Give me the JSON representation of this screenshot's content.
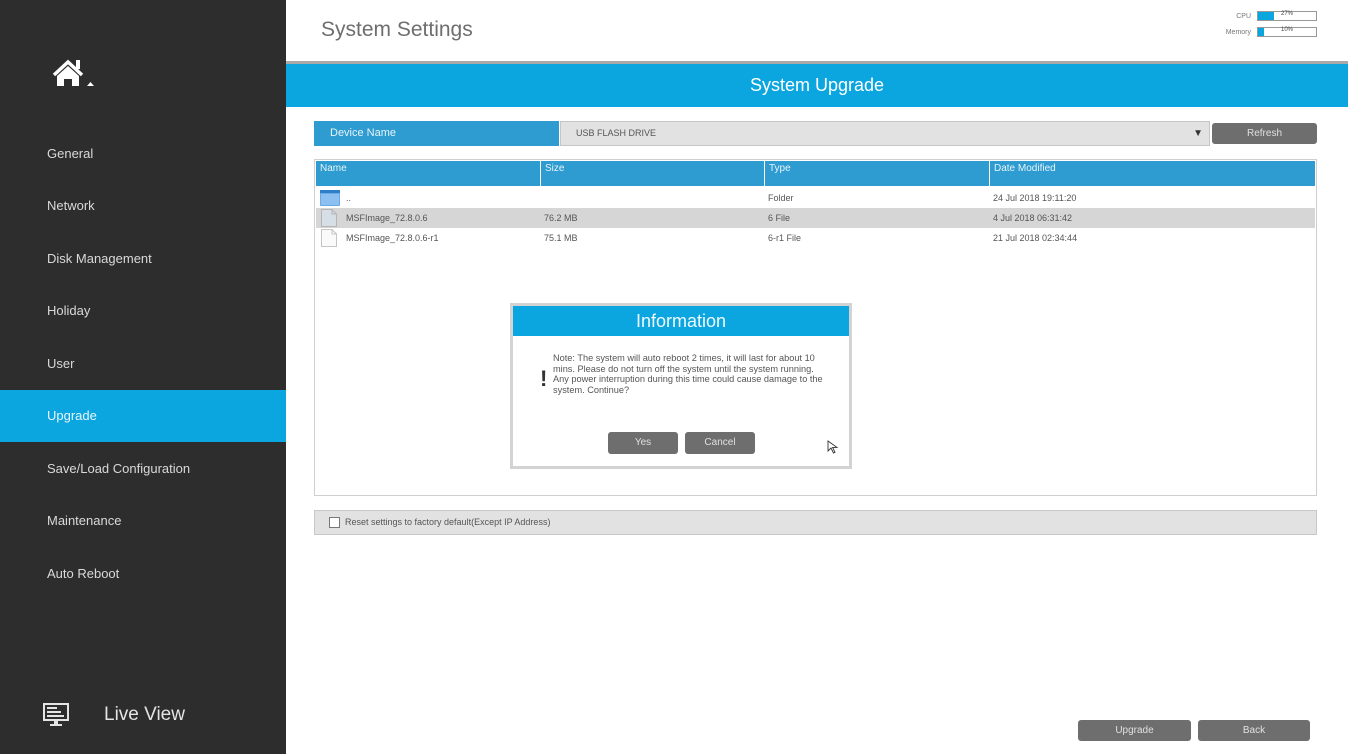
{
  "sidebar": {
    "home_icon": "home-icon",
    "items": [
      {
        "label": "General",
        "active": false
      },
      {
        "label": "Network",
        "active": false
      },
      {
        "label": "Disk Management",
        "active": false
      },
      {
        "label": "Holiday",
        "active": false
      },
      {
        "label": "User",
        "active": false
      },
      {
        "label": "Upgrade",
        "active": true
      },
      {
        "label": "Save/Load Configuration",
        "active": false
      },
      {
        "label": "Maintenance",
        "active": false
      },
      {
        "label": "Auto Reboot",
        "active": false
      }
    ],
    "live_view": {
      "label": "Live View",
      "icon": "monitor-icon"
    }
  },
  "header": {
    "title": "System Settings",
    "resources": [
      {
        "name": "CPU",
        "value_label": "27%",
        "value": 0.27
      },
      {
        "name": "Memory",
        "value_label": "10%",
        "value": 0.1
      }
    ]
  },
  "banner": {
    "title": "System Upgrade"
  },
  "device": {
    "label": "Device Name",
    "selected": "USB FLASH DRIVE",
    "refresh_label": "Refresh"
  },
  "file_table": {
    "columns": [
      "Name",
      "Size",
      "Type",
      "Date Modified"
    ],
    "rows": [
      {
        "icon": "folder-icon",
        "name": "..",
        "size": "",
        "type": "Folder",
        "date": "24 Jul 2018 19:11:20",
        "selected": false
      },
      {
        "icon": "file-icon",
        "name": "MSFImage_72.8.0.6",
        "size": "76.2 MB",
        "type": "6 File",
        "date": "4 Jul 2018 06:31:42",
        "selected": true
      },
      {
        "icon": "file-icon",
        "name": "MSFImage_72.8.0.6-r1",
        "size": "75.1 MB",
        "type": "6-r1 File",
        "date": "21 Jul 2018 02:34:44",
        "selected": false
      }
    ]
  },
  "reset": {
    "label": "Reset settings to factory default(Except IP Address)",
    "checked": false
  },
  "footer": {
    "upgrade_label": "Upgrade",
    "back_label": "Back"
  },
  "dialog": {
    "title": "Information",
    "icon": "!",
    "message": "Note: The system will auto reboot 2 times, it will last for about 10 mins. Please do not turn off the system until the system running. Any power interruption during this time could cause damage to the system. Continue?",
    "yes_label": "Yes",
    "cancel_label": "Cancel"
  },
  "colors": {
    "accent": "#0ba5df",
    "header_blue": "#2e9cd0",
    "sidebar_bg": "#2d2d2d",
    "button_gray": "#6e6e6e"
  }
}
